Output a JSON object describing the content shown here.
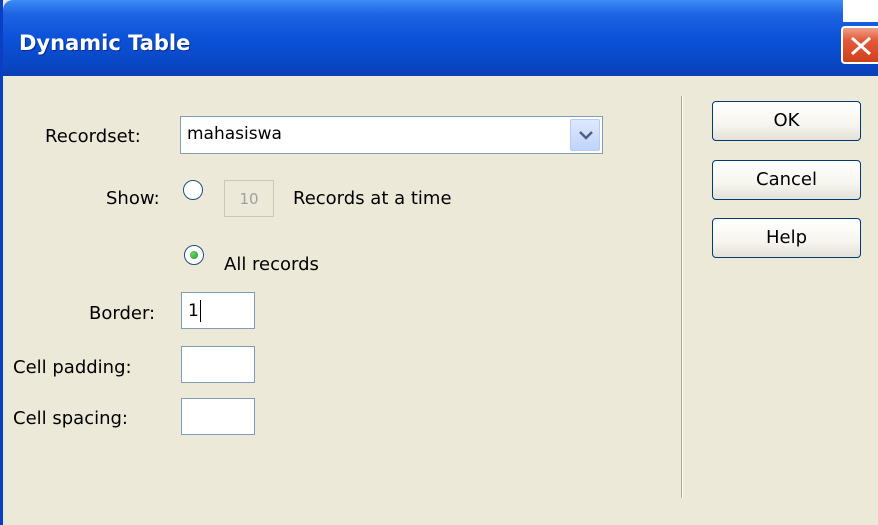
{
  "window": {
    "title": "Dynamic Table"
  },
  "form": {
    "recordset_label": "Recordset:",
    "recordset_value": "mahasiswa",
    "show_label": "Show:",
    "records_count_value": "10",
    "records_at_a_time_label": "Records at a time",
    "all_records_label": "All records",
    "selected_option": "All records",
    "border_label": "Border:",
    "border_value": "1",
    "cell_padding_label": "Cell padding:",
    "cell_padding_value": "",
    "cell_spacing_label": "Cell spacing:",
    "cell_spacing_value": ""
  },
  "buttons": {
    "ok": "OK",
    "cancel": "Cancel",
    "help": "Help"
  },
  "icons": {
    "close": "close-icon",
    "dropdown": "chevron-down-icon",
    "radio_selected_color": "#1f9a1f"
  }
}
